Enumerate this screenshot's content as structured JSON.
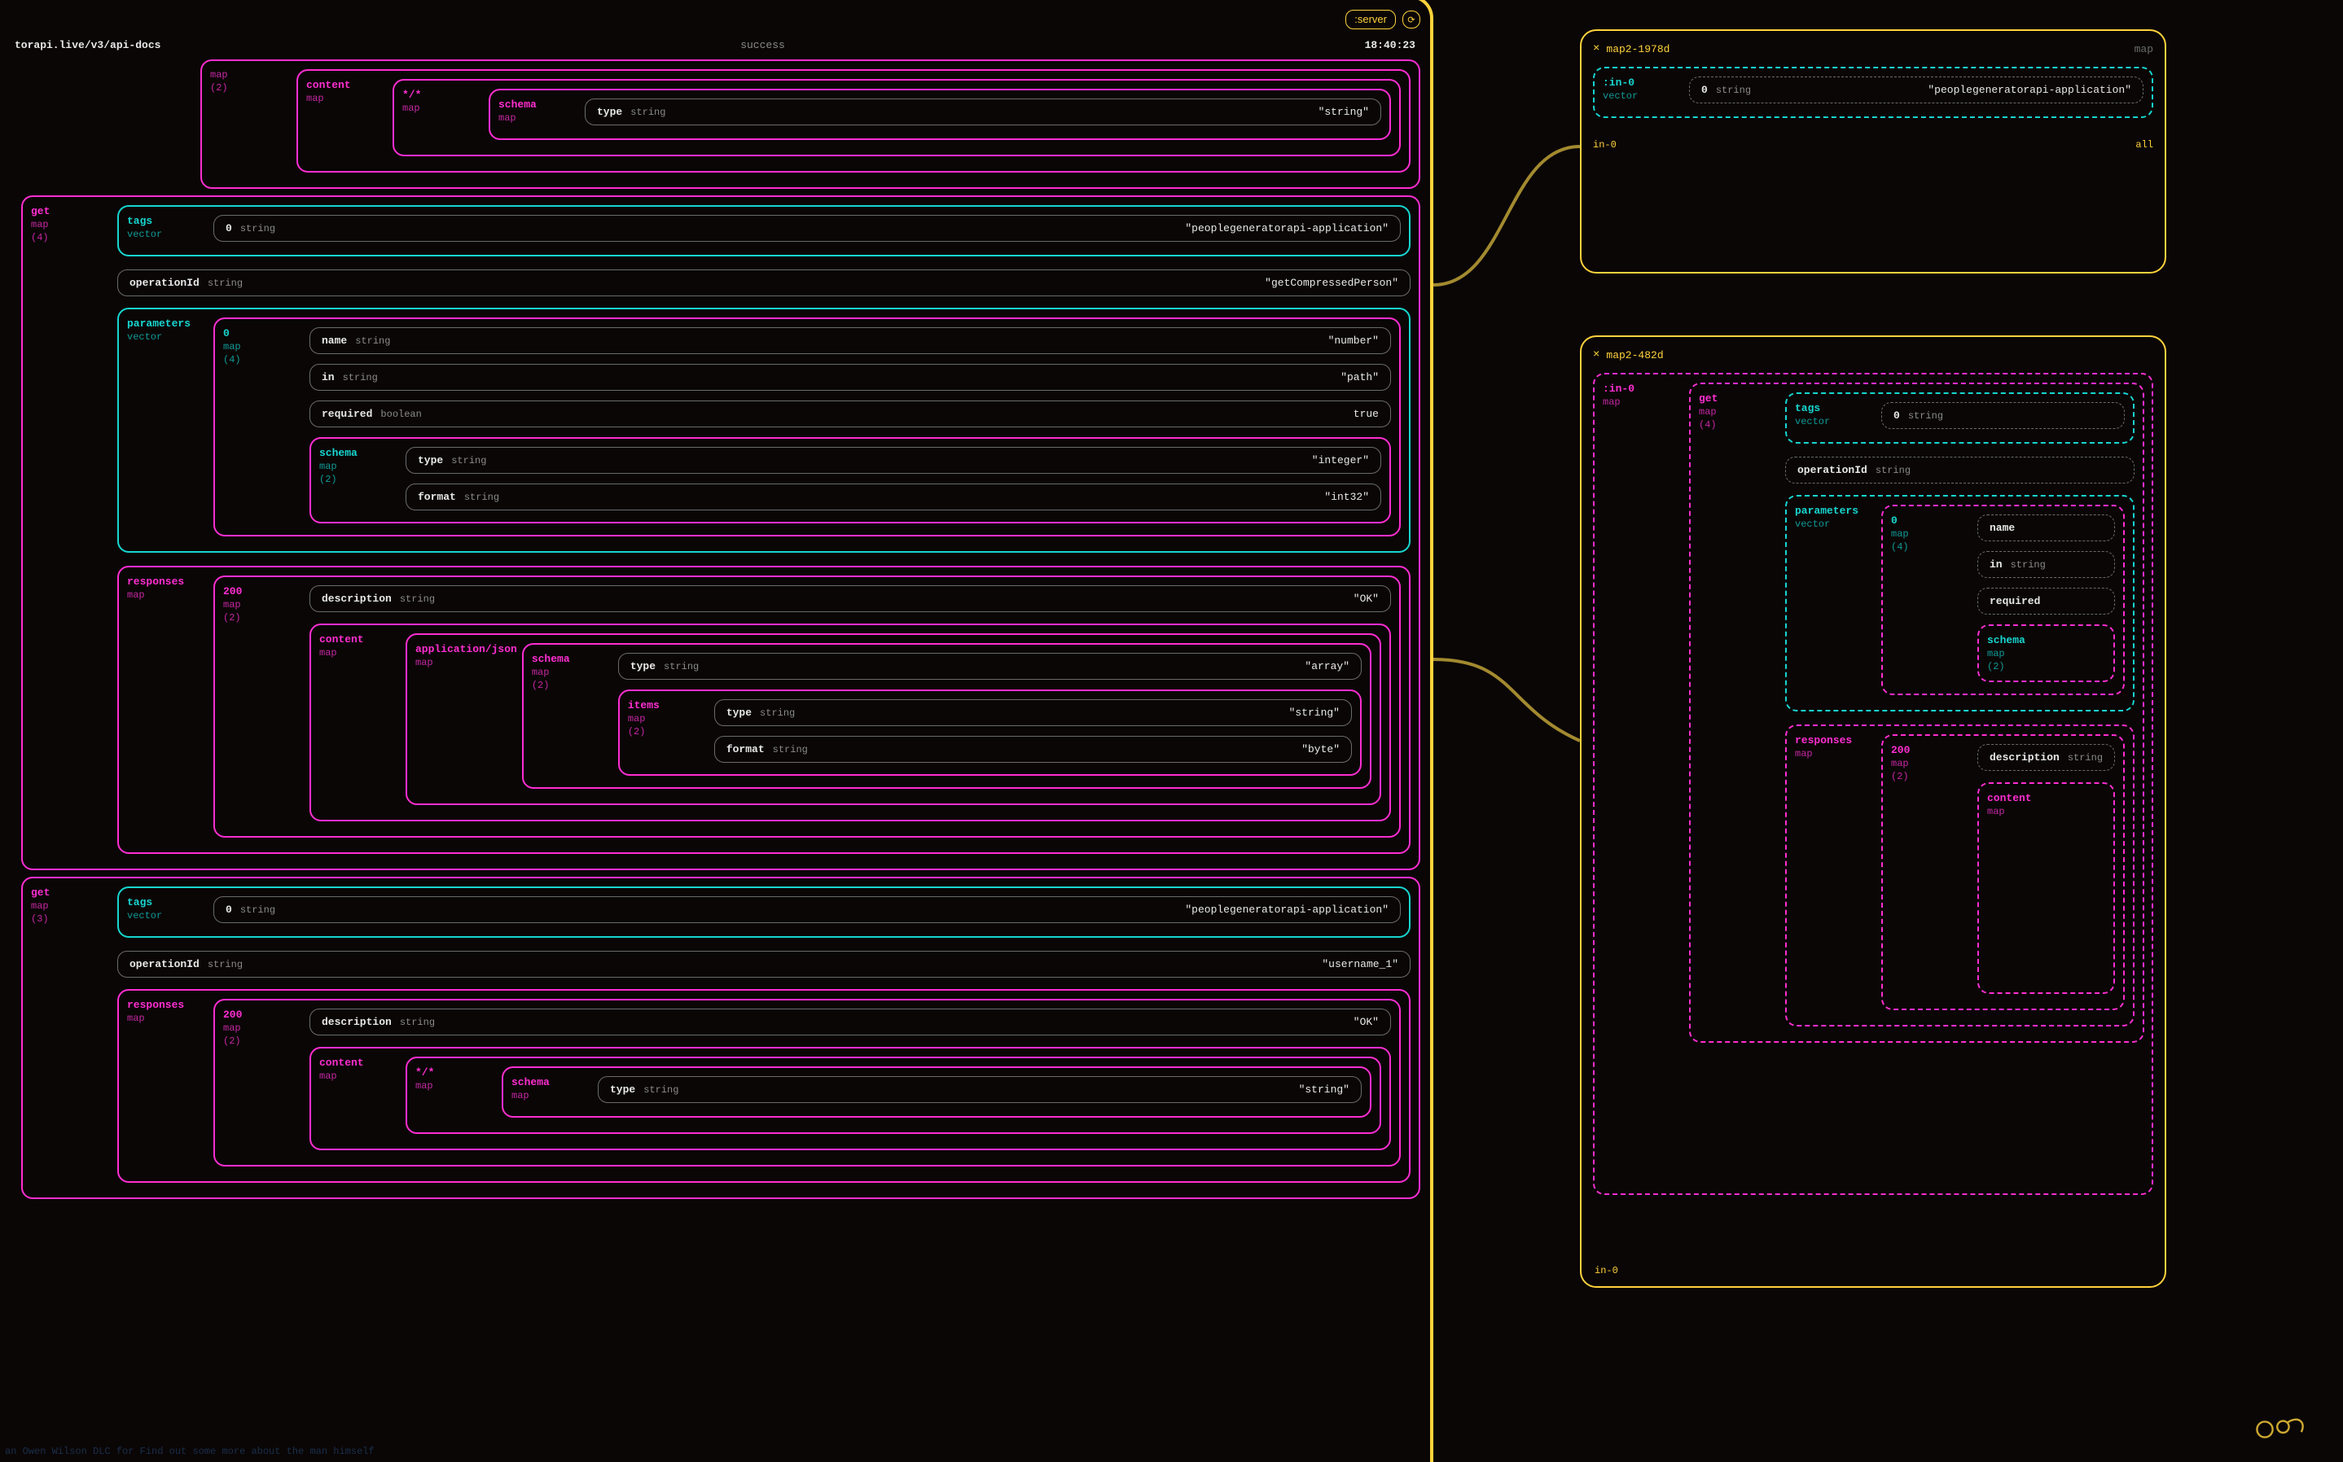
{
  "header": {
    "server_btn": ":server",
    "refresh_icon": "⟳"
  },
  "status": {
    "url": "torapi.live/v3/api-docs",
    "msg": "success",
    "time": "18:40:23"
  },
  "labels": {
    "map": "map",
    "vector": "vector",
    "string": "string",
    "boolean": "boolean",
    "content": "content",
    "schema": "schema",
    "type": "type",
    "items": "items",
    "format": "format",
    "get": "get",
    "tags": "tags",
    "operationId": "operationId",
    "parameters": "parameters",
    "responses": "responses",
    "description": "description",
    "name": "name",
    "in": "in",
    "required": "required",
    "application_json": "application/json",
    "wildcard": "*/*",
    "zero": "0",
    "two": "(2)",
    "three": "(3)",
    "four": "(4)",
    "n200": "200",
    "in0": ":in-0",
    "all": "all"
  },
  "values": {
    "string": "\"string\"",
    "tag0": "\"peoplegeneratorapi-application\"",
    "op_compressed": "\"getCompressedPerson\"",
    "op_username": "\"username_1\"",
    "p_name": "\"number\"",
    "p_in": "\"path\"",
    "p_required": "true",
    "p_schema_type": "\"integer\"",
    "p_schema_format": "\"int32\"",
    "resp_desc": "\"OK\"",
    "resp_type_array": "\"array\"",
    "item_type": "\"string\"",
    "item_format": "\"byte\""
  },
  "map2a": {
    "title": "map2-1978d",
    "in_kind": "vector",
    "idx": "0",
    "idx_t": "string",
    "map_hint": "map",
    "val": "\"peoplegeneratorapi-application\"",
    "foot_l": "in-0",
    "foot_r": "all"
  },
  "map2b": {
    "title": "map2-482d",
    "foot_l": "in-0"
  },
  "faint": "an Owen Wilson DLC for Find out some more about the man himself"
}
